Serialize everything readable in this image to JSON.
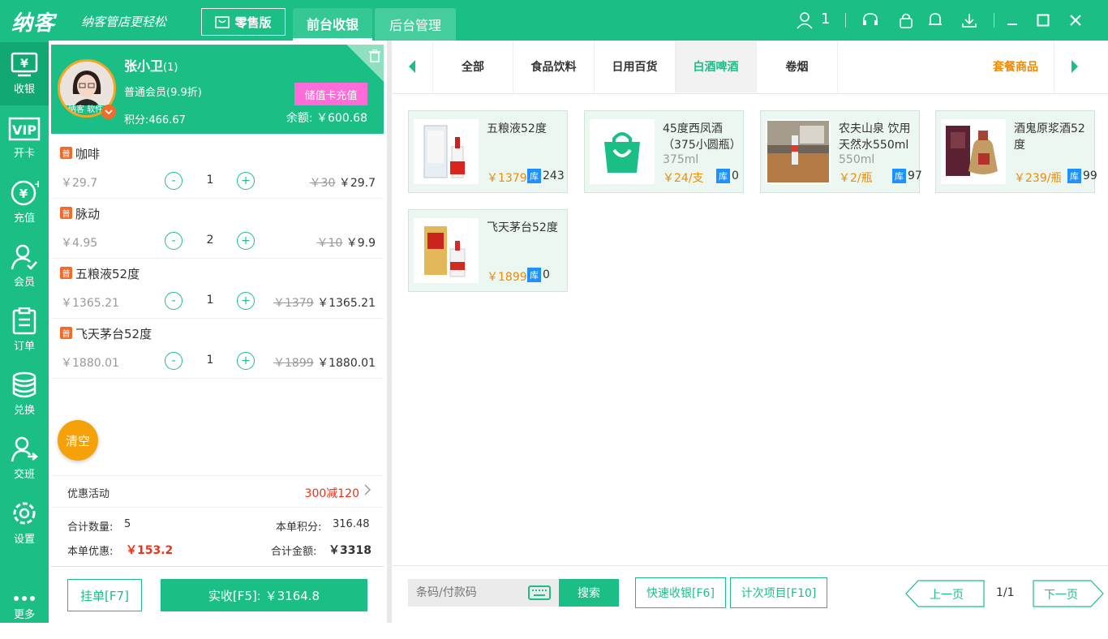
{
  "app": {
    "logo": "纳客",
    "slogan": "纳客管店更轻松",
    "edition": "零售版",
    "tabs": [
      "前台收银",
      "后台管理"
    ],
    "user_count": "1"
  },
  "sidebar": [
    {
      "label": "收银",
      "icon": "cashier-icon"
    },
    {
      "label": "开卡",
      "icon": "vip-card-icon"
    },
    {
      "label": "充值",
      "icon": "recharge-icon"
    },
    {
      "label": "会员",
      "icon": "member-icon"
    },
    {
      "label": "订单",
      "icon": "order-icon"
    },
    {
      "label": "兑换",
      "icon": "exchange-icon"
    },
    {
      "label": "交班",
      "icon": "shift-icon"
    },
    {
      "label": "设置",
      "icon": "settings-icon"
    },
    {
      "label": "更多",
      "icon": "more-icon"
    }
  ],
  "member": {
    "name": "张小卫",
    "count": "(1)",
    "level": "普通会员(9.9折)",
    "points": "积分:466.67",
    "recharge_button": "储值卡充值",
    "balance": "余额: ￥600.68",
    "avatar_caption": "纳客 软件"
  },
  "cart": [
    {
      "badge": "普",
      "name": "咖啡",
      "unit_price": "￥29.7",
      "qty": "1",
      "orig": "￥30",
      "total": "￥29.7"
    },
    {
      "badge": "普",
      "name": "脉动",
      "unit_price": "￥4.95",
      "qty": "2",
      "orig": "￥10",
      "total": "￥9.9"
    },
    {
      "badge": "普",
      "name": "五粮液52度",
      "unit_price": "￥1365.21",
      "qty": "1",
      "orig": "￥1379",
      "total": "￥1365.21"
    },
    {
      "badge": "普",
      "name": "飞天茅台52度",
      "unit_price": "￥1880.01",
      "qty": "1",
      "orig": "￥1899",
      "total": "￥1880.01"
    }
  ],
  "qty_minus": "-",
  "qty_plus": "+",
  "clear_button": "清空",
  "promo": {
    "label": "优惠活动",
    "value": "300减120"
  },
  "totals": {
    "count_label": "合计数量:",
    "count": "5",
    "points_label": "本单积分:",
    "points": "316.48",
    "discount_label": "本单优惠:",
    "discount": "￥153.2",
    "amount_label": "合计金额:",
    "amount": "￥3318"
  },
  "footer": {
    "hang_button": "挂单[F7]",
    "pay_button": "实收[F5]: ￥3164.8"
  },
  "categories": [
    "全部",
    "食品饮料",
    "日用百货",
    "白酒啤酒",
    "卷烟"
  ],
  "active_category": "白酒啤酒",
  "package_category": "套餐商品",
  "stock_badge": "库",
  "products": [
    {
      "name": "五粮液52度",
      "spec": "",
      "price": "￥1379/瓶",
      "stock": "243"
    },
    {
      "name": "45度西凤酒（375小圆瓶）",
      "spec": "375ml",
      "price": "￥24/支",
      "stock": "0"
    },
    {
      "name": "农夫山泉 饮用天然水550ml",
      "spec": "550ml",
      "price": "￥2/瓶",
      "stock": "97"
    },
    {
      "name": "酒鬼原浆酒52度",
      "spec": "",
      "price": "￥239/瓶",
      "stock": "99"
    },
    {
      "name": "飞天茅台52度",
      "spec": "",
      "price": "￥1899/瓶",
      "stock": "0"
    }
  ],
  "bottom": {
    "search_placeholder": "条码/付款码",
    "search_button": "搜索",
    "quick_checkout": "快速收银[F6]",
    "count_items": "计次项目[F10]",
    "prev_page": "上一页",
    "page": "1/1",
    "next_page": "下一页"
  },
  "colors": {
    "brand": "#1bbf86",
    "accent_orange": "#f08a00",
    "recharge_pink": "#ff6bd8",
    "price_red": "#e8341c",
    "stock_blue": "#1e90ff"
  }
}
